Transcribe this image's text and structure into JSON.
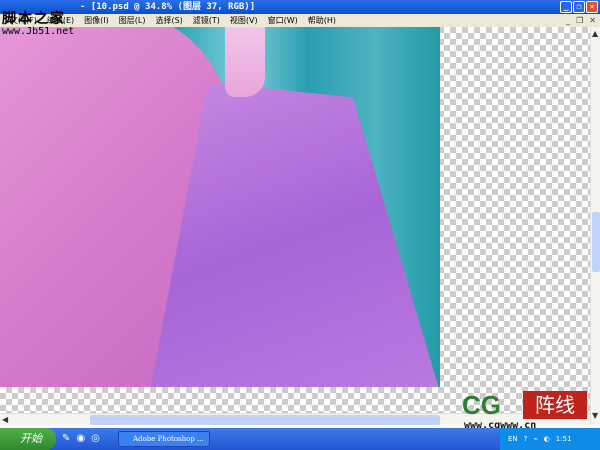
{
  "window": {
    "title": "- [10.psd @ 34.8% (图层 37, RGB)]",
    "min": "_",
    "max": "❐",
    "close": "✕"
  },
  "menu": [
    "文件(F)",
    "编辑(E)",
    "图像(I)",
    "图层(L)",
    "选择(S)",
    "滤镜(T)",
    "视图(V)",
    "窗口(W)",
    "帮助(H)"
  ],
  "doc_controls": {
    "min": "_",
    "max": "❐",
    "close": "✕"
  },
  "watermark": {
    "site_name": "脚本之家",
    "site_url": "www.Jb51.net"
  },
  "logo": {
    "cg": "CG",
    "red": "阵线",
    "url": "www.cgwww.cn"
  },
  "taskbar": {
    "start": "开始",
    "task": "Adobe Photoshop ...",
    "tray_lang": "EN",
    "time": "1:51"
  }
}
